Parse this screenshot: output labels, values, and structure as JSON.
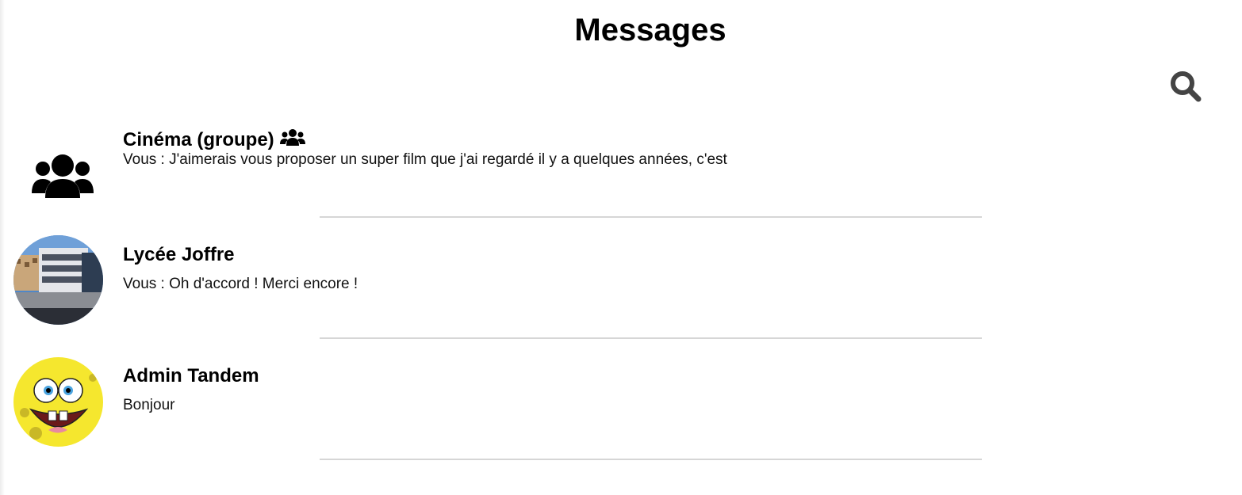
{
  "header": {
    "title": "Messages"
  },
  "search": {
    "icon": "search-icon"
  },
  "conversations": [
    {
      "name": "Cinéma (groupe)",
      "is_group": true,
      "avatar": "users-group-icon",
      "preview": "Vous : J'aimerais vous proposer un super film que j'ai regardé il y a quelques années, c'est"
    },
    {
      "name": "Lycée Joffre",
      "is_group": false,
      "avatar": "school-building-photo",
      "preview": "Vous : Oh d'accord ! Merci encore !"
    },
    {
      "name": "Admin Tandem",
      "is_group": false,
      "avatar": "spongebob-avatar",
      "preview": "Bonjour"
    }
  ],
  "colors": {
    "divider": "#d6d6d6",
    "search_icon": "#444444",
    "text": "#000000"
  }
}
